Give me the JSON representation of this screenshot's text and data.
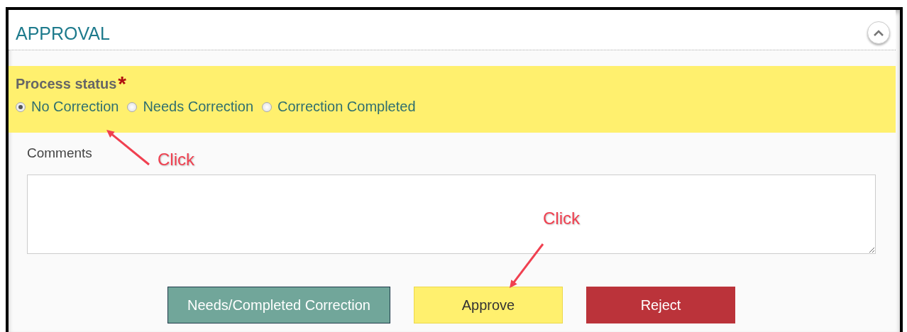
{
  "panel": {
    "title": "APPROVAL",
    "expanded": true
  },
  "process_status": {
    "label": "Process status",
    "required_mark": "*",
    "options": [
      {
        "label": "No Correction",
        "selected": true
      },
      {
        "label": "Needs Correction",
        "selected": false
      },
      {
        "label": "Correction Completed",
        "selected": false
      }
    ]
  },
  "comments": {
    "label": "Comments"
  },
  "buttons": [
    {
      "label": "Needs/Completed Correction",
      "kind": "teal"
    },
    {
      "label": "Approve",
      "kind": "yellow"
    },
    {
      "label": "Reject",
      "kind": "red"
    }
  ],
  "annotations": [
    {
      "text": "Click"
    },
    {
      "text": "Click"
    }
  ]
}
